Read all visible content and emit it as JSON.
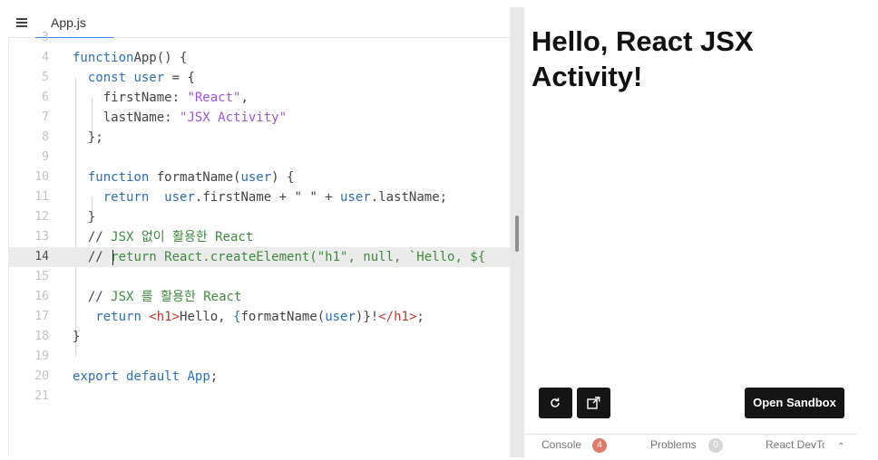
{
  "editor": {
    "tab": {
      "label": "App.js"
    },
    "active_line": "14",
    "lines": [
      {
        "num": "3",
        "tokens": []
      },
      {
        "num": "4",
        "tokens": [
          [
            "kw",
            "function"
          ],
          [
            "",
            "App() {"
          ]
        ]
      },
      {
        "num": "5",
        "tokens": [
          [
            "",
            "  "
          ],
          [
            "kw",
            "const"
          ],
          [
            "",
            ""
          ],
          [
            "kw",
            " user"
          ],
          [
            "",
            " = {"
          ]
        ]
      },
      {
        "num": "6",
        "tokens": [
          [
            "",
            "    firstName: "
          ],
          [
            "str",
            "\"React\""
          ],
          [
            "",
            ","
          ]
        ]
      },
      {
        "num": "7",
        "tokens": [
          [
            "",
            "    lastName: "
          ],
          [
            "str",
            "\"JSX Activity\""
          ]
        ]
      },
      {
        "num": "8",
        "tokens": [
          [
            "",
            "  };"
          ]
        ]
      },
      {
        "num": "9",
        "tokens": []
      },
      {
        "num": "10",
        "tokens": [
          [
            "",
            "  "
          ],
          [
            "kw",
            "function"
          ],
          [
            "",
            " formatName("
          ],
          [
            "kw",
            "user"
          ],
          [
            "",
            ") {"
          ]
        ]
      },
      {
        "num": "11",
        "tokens": [
          [
            "",
            "    "
          ],
          [
            "kw",
            "return"
          ],
          [
            " ",
            ""
          ],
          [
            "kw",
            " user"
          ],
          [
            "",
            ".firstName + \" \" + "
          ],
          [
            "kw",
            "user"
          ],
          [
            "",
            ".lastName;"
          ]
        ]
      },
      {
        "num": "12",
        "tokens": [
          [
            "",
            "  }"
          ]
        ]
      },
      {
        "num": "13",
        "tokens": [
          [
            "",
            "  // "
          ],
          [
            "cm",
            "JSX 없이 활용한 React"
          ]
        ]
      },
      {
        "num": "14",
        "tokens": [
          [
            "",
            "  // "
          ],
          [
            "cm",
            "return React.createElement(\"h1\", null, `Hello, ${"
          ]
        ]
      },
      {
        "num": "15",
        "tokens": []
      },
      {
        "num": "16",
        "tokens": [
          [
            "",
            "  // "
          ],
          [
            "cm",
            "JSX 를 활용한 React"
          ]
        ]
      },
      {
        "num": "17",
        "tokens": [
          [
            "",
            "   "
          ],
          [
            "kw",
            "return"
          ],
          [
            "",
            " "
          ],
          [
            "tag",
            "<h1>"
          ],
          [
            "",
            "Hello, "
          ],
          [
            "kw",
            "{"
          ],
          [
            "",
            "formatName("
          ],
          [
            "kw",
            "user"
          ],
          [
            ")",
            ""
          ],
          [
            "",
            "}"
          ],
          [
            "",
            "!"
          ],
          [
            "tag",
            "</h1>"
          ],
          [
            "",
            ";"
          ]
        ]
      },
      {
        "num": "18",
        "tokens": [
          [
            "",
            "}"
          ]
        ]
      },
      {
        "num": "19",
        "tokens": []
      },
      {
        "num": "20",
        "tokens": [
          [
            "kw",
            "export"
          ],
          [
            "",
            " "
          ],
          [
            "kw",
            "default"
          ],
          [
            "",
            " "
          ],
          [
            "kw",
            "App"
          ],
          [
            "",
            ";"
          ]
        ]
      },
      {
        "num": "21",
        "tokens": []
      }
    ]
  },
  "preview": {
    "heading": "Hello, React JSX Activity!",
    "refresh_icon": "refresh-icon",
    "open_new_window_icon": "external-link-icon",
    "open_sandbox_label": "Open Sandbox"
  },
  "bottom_bar": {
    "console_label": "Console",
    "console_count": "4",
    "problems_label": "Problems",
    "problems_count": "0",
    "devtools_label": "React DevTools",
    "caret_icon": "chevron-up-icon"
  },
  "colors": {
    "keyword": "#2f6fb2",
    "string": "#a056d6",
    "comment": "#3f8a3f",
    "tag": "#c0392b",
    "active_line_bg": "#ebebeb",
    "button_bg": "#151515",
    "console_badge": "#e07a6a"
  }
}
